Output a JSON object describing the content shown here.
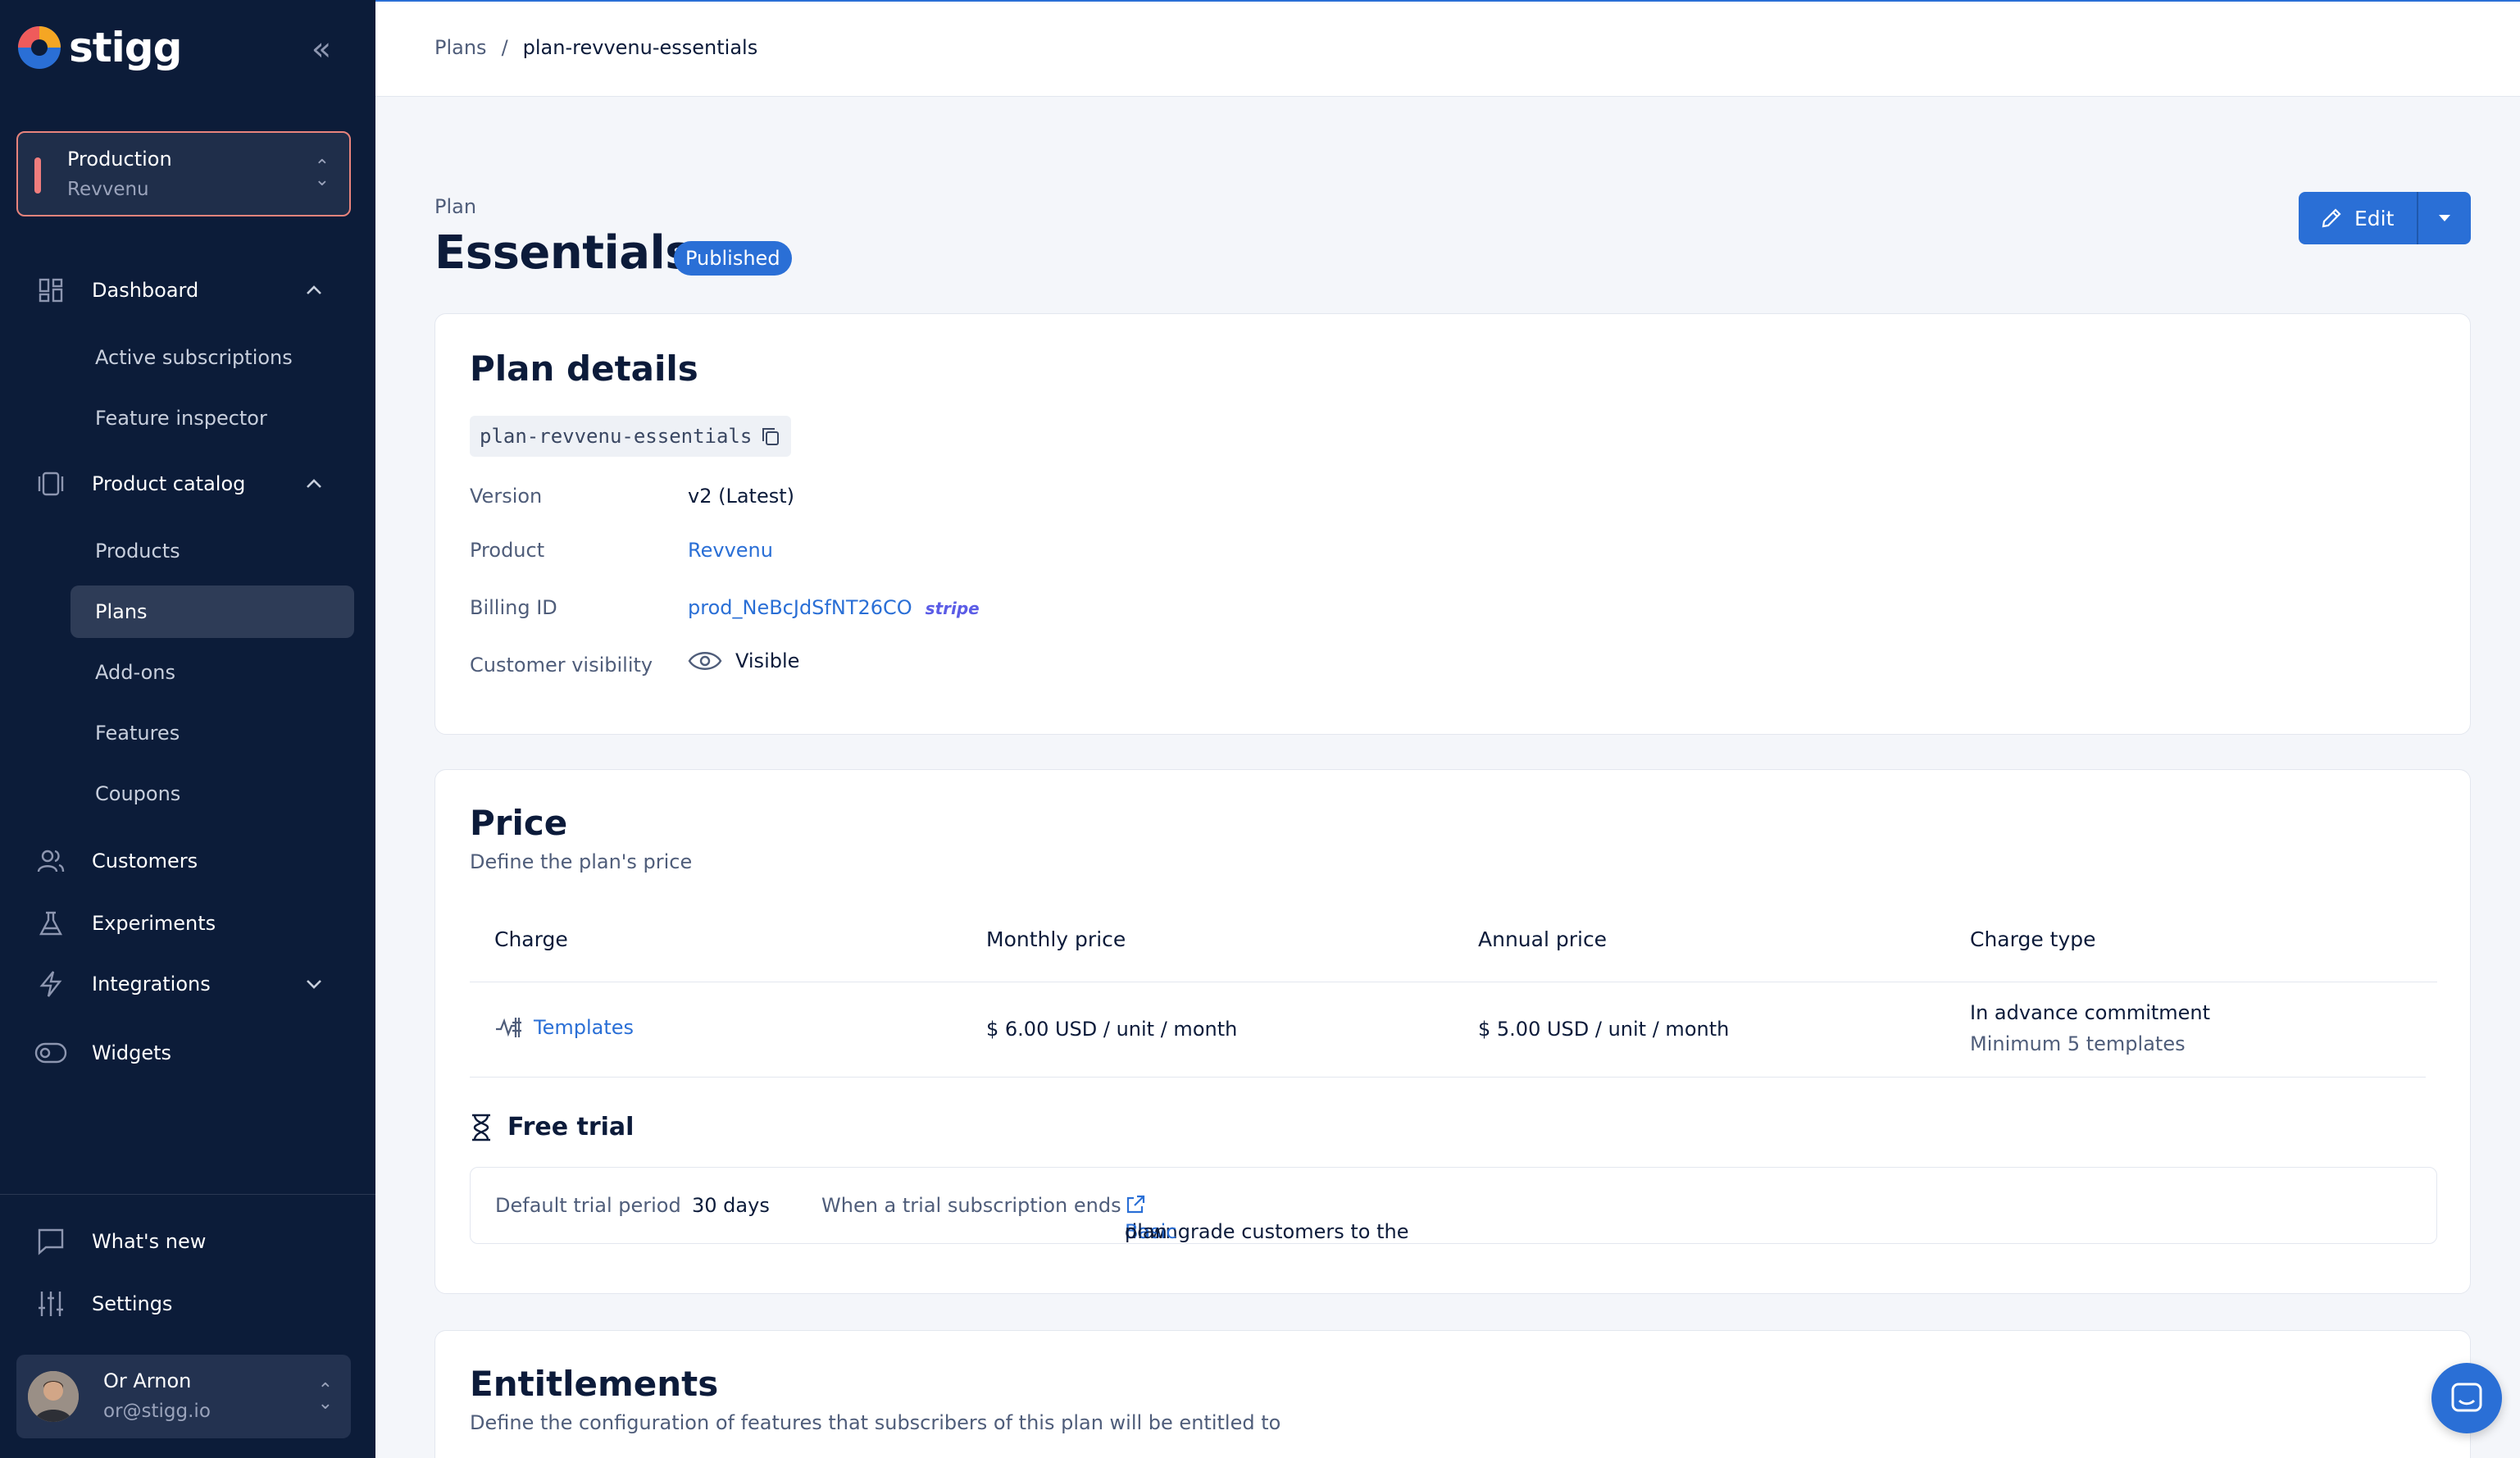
{
  "app": {
    "brand": "stigg"
  },
  "environment": {
    "name": "Production",
    "product": "Revvenu"
  },
  "sidebar": {
    "dashboard": "Dashboard",
    "dashboard_items": [
      "Active subscriptions",
      "Feature inspector"
    ],
    "product_catalog": "Product catalog",
    "catalog_items": [
      "Products",
      "Plans",
      "Add-ons",
      "Features",
      "Coupons"
    ],
    "active_item": "Plans",
    "customers": "Customers",
    "experiments": "Experiments",
    "integrations": "Integrations",
    "widgets": "Widgets",
    "whats_new": "What's new",
    "settings": "Settings"
  },
  "user": {
    "name": "Or Arnon",
    "email": "or@stigg.io"
  },
  "breadcrumb": {
    "root": "Plans",
    "separator": "/",
    "current": "plan-revvenu-essentials"
  },
  "header": {
    "kicker": "Plan",
    "title": "Essentials",
    "status": "Published",
    "edit_label": "Edit"
  },
  "plan_details": {
    "title": "Plan details",
    "plan_id": "plan-revvenu-essentials",
    "rows": {
      "version_label": "Version",
      "version_value": "v2 (Latest)",
      "product_label": "Product",
      "product_value": "Revvenu",
      "billing_label": "Billing ID",
      "billing_value": "prod_NeBcJdSfNT26CO",
      "billing_provider": "stripe",
      "visibility_label": "Customer visibility",
      "visibility_value": "Visible"
    }
  },
  "price": {
    "title": "Price",
    "subtitle": "Define the plan's price",
    "columns": [
      "Charge",
      "Monthly price",
      "Annual price",
      "Charge type"
    ],
    "row": {
      "charge": "Templates",
      "monthly": "$ 6.00 USD / unit / month",
      "annual": "$ 5.00 USD / unit / month",
      "charge_type": "In advance commitment",
      "charge_type_detail": "Minimum 5 templates"
    },
    "free_trial": {
      "title": "Free trial",
      "period_label": "Default trial period",
      "period_value": "30 days",
      "ends_label": "When a trial subscription ends",
      "ends_value_prefix": "downgrade customers to the",
      "ends_plan": "Basic",
      "ends_value_suffix": "plan"
    }
  },
  "entitlements": {
    "title": "Entitlements",
    "subtitle": "Define the configuration of features that subscribers of this plan will be entitled to"
  },
  "colors": {
    "sidebar_bg": "#0c1c39",
    "accent": "#2a6fd6",
    "env_border": "#e8837c"
  }
}
